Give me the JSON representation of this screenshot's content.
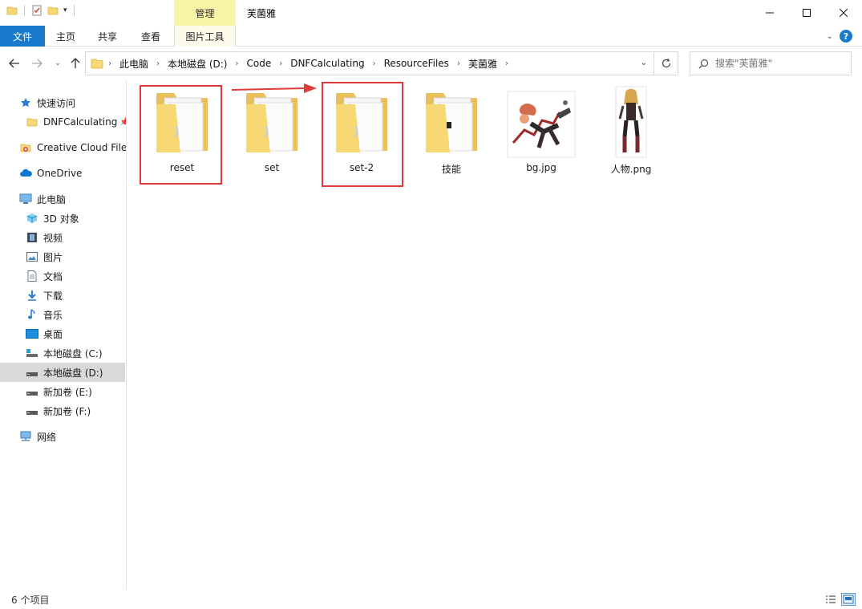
{
  "window": {
    "title": "芙菌雅",
    "context_tab": "管理"
  },
  "ribbon": {
    "tabs": [
      "文件",
      "主页",
      "共享",
      "查看",
      "图片工具"
    ]
  },
  "address": {
    "crumbs": [
      "此电脑",
      "本地磁盘 (D:)",
      "Code",
      "DNFCalculating",
      "ResourceFiles",
      "芙菌雅"
    ]
  },
  "search": {
    "placeholder": "搜索\"芙菌雅\""
  },
  "sidebar": {
    "items": [
      {
        "label": "快速访问",
        "icon": "star-icon"
      },
      {
        "label": "DNFCalculating",
        "icon": "folder-icon",
        "pinned": true
      },
      {
        "label": "Creative Cloud Files",
        "icon": "creative-cloud-icon"
      },
      {
        "label": "OneDrive",
        "icon": "cloud-icon"
      },
      {
        "label": "此电脑",
        "icon": "computer-icon"
      },
      {
        "label": "3D 对象",
        "icon": "cube-icon"
      },
      {
        "label": "视频",
        "icon": "film-icon"
      },
      {
        "label": "图片",
        "icon": "picture-icon"
      },
      {
        "label": "文档",
        "icon": "document-icon"
      },
      {
        "label": "下载",
        "icon": "download-icon"
      },
      {
        "label": "音乐",
        "icon": "music-icon"
      },
      {
        "label": "桌面",
        "icon": "desktop-icon"
      },
      {
        "label": "本地磁盘 (C:)",
        "icon": "drive-icon"
      },
      {
        "label": "本地磁盘 (D:)",
        "icon": "drive-icon",
        "selected": true
      },
      {
        "label": "新加卷 (E:)",
        "icon": "drive-icon"
      },
      {
        "label": "新加卷 (F:)",
        "icon": "drive-icon"
      },
      {
        "label": "网络",
        "icon": "network-icon"
      }
    ]
  },
  "files": [
    {
      "name": "reset",
      "type": "folder",
      "highlighted": true
    },
    {
      "name": "set",
      "type": "folder"
    },
    {
      "name": "set-2",
      "type": "folder",
      "highlighted": true
    },
    {
      "name": "技能",
      "type": "folder"
    },
    {
      "name": "bg.jpg",
      "type": "image"
    },
    {
      "name": "人物.png",
      "type": "image"
    }
  ],
  "status": {
    "count": "6 个项目"
  },
  "colors": {
    "accent": "#1979ca",
    "context_tab": "#f7f3a7",
    "highlight": "#e03b3b",
    "folder": "#f8d775"
  }
}
